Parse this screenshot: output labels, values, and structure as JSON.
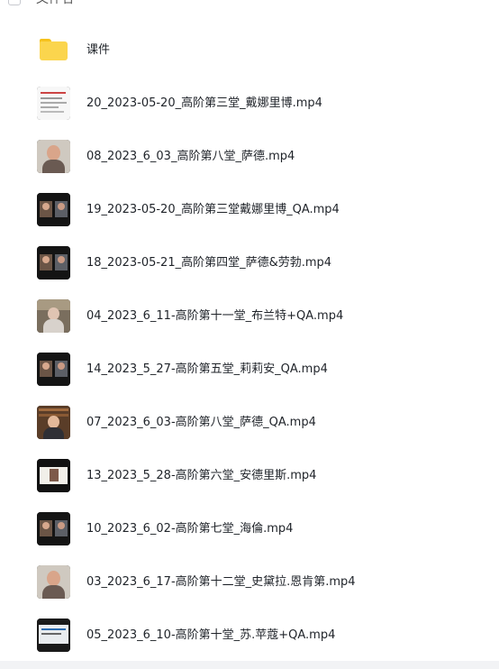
{
  "header": {
    "label": "文件名"
  },
  "items": [
    {
      "name": "课件",
      "type": "folder",
      "icon": "folder-icon"
    },
    {
      "name": "20_2023-05-20_高阶第三堂_戴娜里博.mp4",
      "type": "video",
      "thumb": "document"
    },
    {
      "name": "08_2023_6_03_高阶第八堂_萨德.mp4",
      "type": "video",
      "thumb": "person-light"
    },
    {
      "name": "19_2023-05-20_高阶第三堂戴娜里博_QA.mp4",
      "type": "video",
      "thumb": "dark-call"
    },
    {
      "name": "18_2023-05-21_高阶第四堂_萨德&劳勃.mp4",
      "type": "video",
      "thumb": "dark-call"
    },
    {
      "name": "04_2023_6_11-高阶第十一堂_布兰特+QA.mp4",
      "type": "video",
      "thumb": "person-room"
    },
    {
      "name": "14_2023_5_27-高阶第五堂_莉莉安_QA.mp4",
      "type": "video",
      "thumb": "dark-call"
    },
    {
      "name": "07_2023_6_03-高阶第八堂_萨德_QA.mp4",
      "type": "video",
      "thumb": "person-shelf"
    },
    {
      "name": "13_2023_5_28-高阶第六堂_安德里斯.mp4",
      "type": "video",
      "thumb": "slide"
    },
    {
      "name": "10_2023_6_02-高阶第七堂_海倫.mp4",
      "type": "video",
      "thumb": "dark-call"
    },
    {
      "name": "03_2023_6_17-高阶第十二堂_史黛拉.恩肯第.mp4",
      "type": "video",
      "thumb": "person-light"
    },
    {
      "name": "05_2023_6_10-高阶第十堂_苏.苹蔻+QA.mp4",
      "type": "video",
      "thumb": "screen"
    }
  ]
}
